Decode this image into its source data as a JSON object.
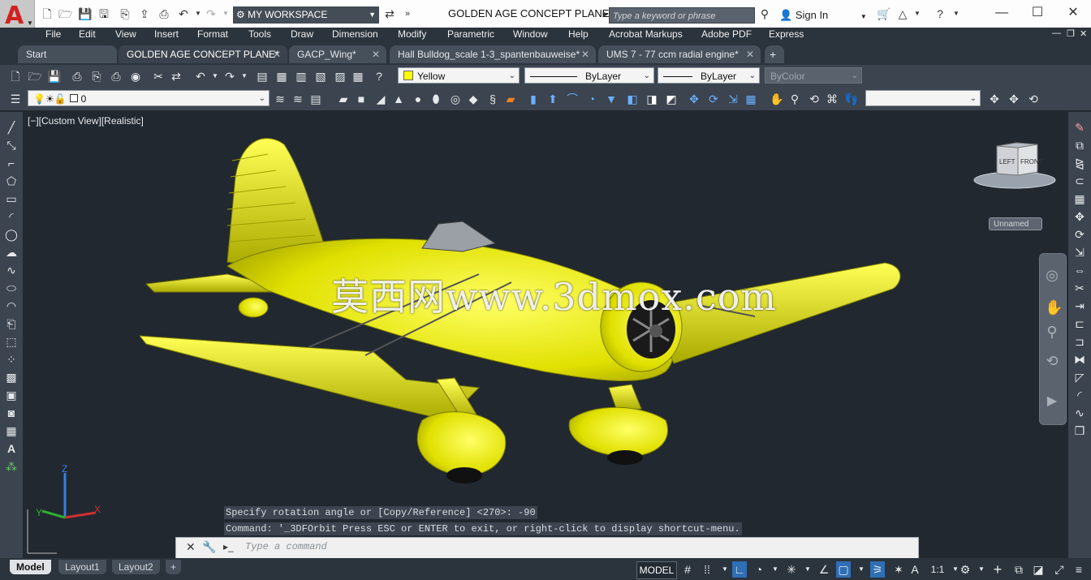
{
  "app": {
    "logo_letter": "A",
    "window_title": "GOLDEN AGE CONCEPT PLANE.d...",
    "workspace": "MY WORKSPACE"
  },
  "search": {
    "placeholder": "Type a keyword or phrase"
  },
  "account": {
    "signin_label": "Sign In"
  },
  "menu": [
    "File",
    "Edit",
    "View",
    "Insert",
    "Format",
    "Tools",
    "Draw",
    "Dimension",
    "Modify",
    "Parametric",
    "Window",
    "Help",
    "Acrobat Markups",
    "Adobe PDF",
    "Express"
  ],
  "tabs": [
    {
      "label": "Start"
    },
    {
      "label": "GOLDEN AGE CONCEPT PLANE*",
      "active": true
    },
    {
      "label": "GACP_Wing*"
    },
    {
      "label": "Hall Bulldog_scale 1-3_spantenbauweise*"
    },
    {
      "label": "UMS 7 - 77 ccm radial engine*"
    }
  ],
  "properties": {
    "color": "Yellow",
    "linetype": "ByLayer",
    "lineweight": "ByLayer",
    "plotstyle": "ByColor",
    "layer": "0"
  },
  "viewport": {
    "label": "[−][Custom View][Realistic]",
    "viewcube_left": "LEFT",
    "viewcube_front": "FRONT",
    "ucs_name": "Unnamed",
    "watermark": "莫西网www.3dmox.com",
    "axis_x": "X",
    "axis_y": "Y",
    "axis_z": "Z"
  },
  "command": {
    "history": [
      "Specify rotation angle or [Copy/Reference] <270>: -90",
      "Command: '_3DFOrbit Press ESC or ENTER to exit, or right-click to display shortcut-menu."
    ],
    "placeholder": "Type a command"
  },
  "layout_tabs": [
    {
      "label": "Model",
      "active": true
    },
    {
      "label": "Layout1"
    },
    {
      "label": "Layout2"
    }
  ],
  "status": {
    "model_label": "MODEL",
    "scale": "1:1"
  },
  "colors": {
    "model_body": "#e6e600",
    "viewport_bg": "#212830",
    "panel_bg": "#3c444f"
  }
}
